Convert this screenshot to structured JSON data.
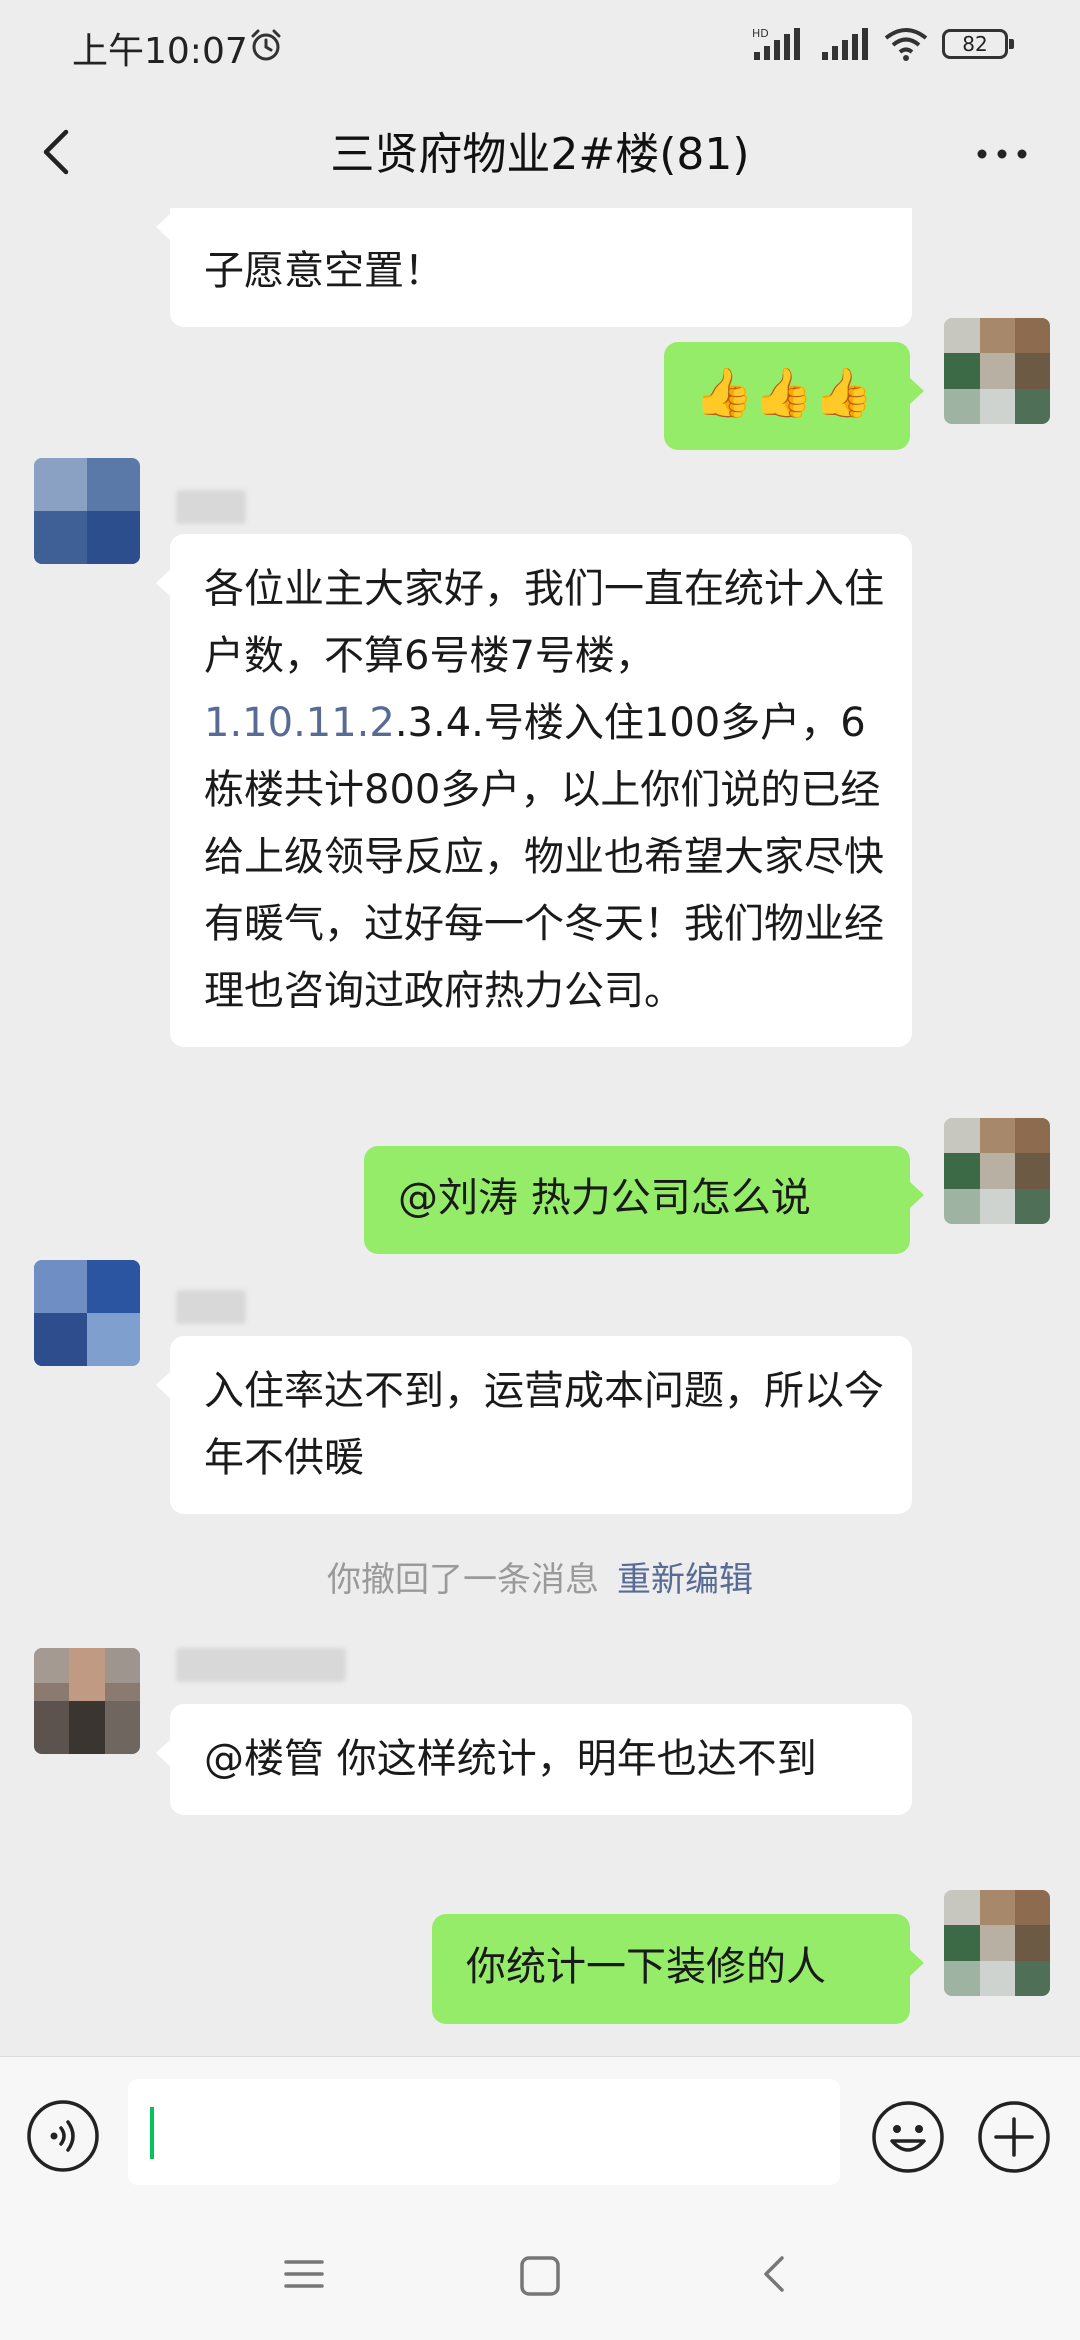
{
  "status_bar": {
    "time": "上午10:07",
    "network": "HD",
    "battery": "82"
  },
  "header": {
    "title": "三贤府物业2#楼(81)"
  },
  "messages": [
    {
      "direction": "in",
      "text": "子愿意空置！"
    },
    {
      "direction": "out",
      "text": "👍👍👍"
    },
    {
      "direction": "in",
      "link_text": "1.10.11.2",
      "text_before": "各位业主大家好，我们一直在统计入住户数，不算6号楼7号楼，",
      "text_after": ".3.4.号楼入住100多户，6栋楼共计800多户，以上你们说的已经给上级领导反应，物业也希望大家尽快有暖气，过好每一个冬天！我们物业经理也咨询过政府热力公司。"
    },
    {
      "direction": "out",
      "text": "@刘涛  热力公司怎么说"
    },
    {
      "direction": "in",
      "text": "入住率达不到，运营成本问题，所以今年不供暖"
    },
    {
      "direction": "in",
      "text": "@楼管  你这样统计，明年也达不到"
    },
    {
      "direction": "out",
      "text": "你统计一下装修的人"
    }
  ],
  "system_message": {
    "text": "你撤回了一条消息",
    "action": "重新编辑"
  },
  "input": {
    "value": "",
    "placeholder": ""
  },
  "icons": {
    "back": "back-arrow-icon",
    "more": "more-dots-icon",
    "voice": "voice-icon",
    "emoji": "emoji-icon",
    "plus": "plus-icon",
    "alarm": "alarm-clock-icon",
    "signal": "signal-icon",
    "wifi": "wifi-icon"
  },
  "colors": {
    "outgoing_bubble": "#95ec69",
    "incoming_bubble": "#ffffff",
    "background": "#ededed",
    "link": "#576b95"
  }
}
